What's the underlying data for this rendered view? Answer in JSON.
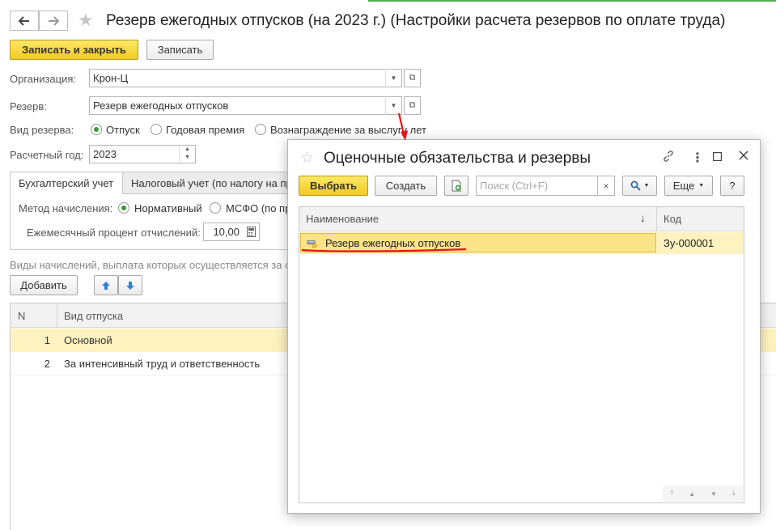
{
  "window": {
    "title": "Резерв ежегодных отпусков (на 2023 г.) (Настройки расчета резервов по оплате труда)"
  },
  "toolbar": {
    "save_close_label": "Записать и закрыть",
    "save_label": "Записать"
  },
  "form": {
    "organization_label": "Организация:",
    "organization_value": "Крон-Ц",
    "reserve_label": "Резерв:",
    "reserve_value": "Резерв ежегодных отпусков",
    "reserve_kind_label": "Вид резерва:",
    "reserve_kinds": [
      "Отпуск",
      "Годовая премия",
      "Вознаграждение за выслугу лет"
    ],
    "reserve_kind_selected": 0,
    "year_label": "Расчетный год:",
    "year_value": "2023"
  },
  "tabs": [
    "Бухгалтерский учет",
    "Налоговый учет (по налогу на пр"
  ],
  "accounting": {
    "method_label": "Метод начисления:",
    "methods": [
      "Нормативный",
      "МСФО (по пр"
    ],
    "method_selected": 0,
    "percent_label": "Ежемесячный процент отчислений:",
    "percent_value": "10,00"
  },
  "accruals": {
    "caption": "Виды начислений, выплата которых осуществляется за с",
    "add_label": "Добавить",
    "columns": [
      "N",
      "Вид отпуска"
    ],
    "rows": [
      {
        "n": "1",
        "name": "Основной"
      },
      {
        "n": "2",
        "name": "За интенсивный труд и ответственность"
      }
    ]
  },
  "dialog": {
    "title": "Оценочные обязательства и резервы",
    "select_label": "Выбрать",
    "create_label": "Создать",
    "search_placeholder": "Поиск (Ctrl+F)",
    "more_label": "Еще",
    "help_label": "?",
    "columns": [
      "Наименование",
      "Код"
    ],
    "sort_indicator": "↓",
    "rows": [
      {
        "name": "Резерв ежегодных отпусков",
        "code": "Зу-000001"
      }
    ]
  },
  "colors": {
    "accent_yellow": "#f5d635",
    "selection_yellow": "#fbe79a",
    "row_highlight": "#fdf2c0",
    "annotation_red": "#e8141c",
    "radio_green": "#3a9b3a"
  }
}
